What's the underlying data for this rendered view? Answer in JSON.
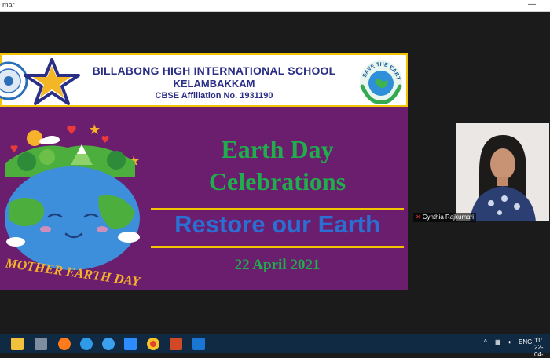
{
  "window": {
    "title": "mar",
    "minimize_glyph": "—"
  },
  "slide": {
    "school_name": "BILLABONG HIGH INTERNATIONAL SCHOOL",
    "school_location": "KELAMBAKKAM",
    "affiliation": "CBSE Affiliation No. 1931190",
    "save_logo_text": "SAVE THE EARTH",
    "art_caption": "MOTHER EARTH DAY",
    "heading_line1": "Earth Day",
    "heading_line2": "Celebrations",
    "subheading": "Restore our Earth",
    "date": "22 April 2021",
    "colors": {
      "background": "#6b1d6e",
      "green": "#1fae4b",
      "blue": "#2a6fd1",
      "gold": "#f2c400"
    }
  },
  "participant": {
    "name": "Cynthia Rajkumari",
    "mic_icon": "mic-muted-icon"
  },
  "taskbar": {
    "icons": [
      "file-explorer-icon",
      "mail-icon",
      "firefox-icon",
      "edge-icon",
      "ie-icon",
      "zoom-icon",
      "chrome-icon",
      "powerpoint-icon",
      "media-player-icon"
    ],
    "language": "ENG",
    "time": "11:",
    "date": "22-04-"
  }
}
